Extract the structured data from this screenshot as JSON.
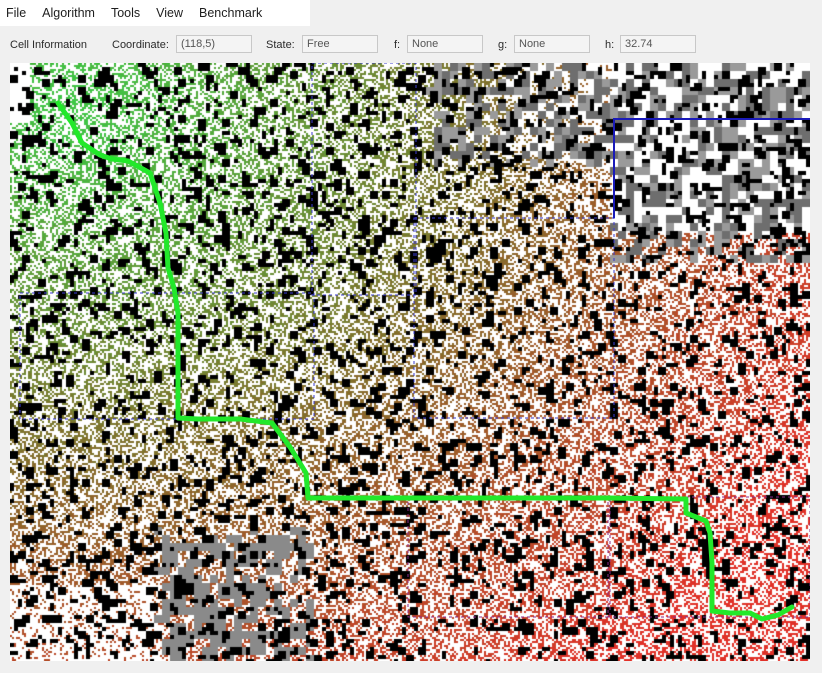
{
  "menu": {
    "items": [
      {
        "label": "File"
      },
      {
        "label": "Algorithm"
      },
      {
        "label": "Tools"
      },
      {
        "label": "View"
      },
      {
        "label": "Benchmark"
      }
    ]
  },
  "cell_info": {
    "title": "Cell Information",
    "coordinate_label": "Coordinate:",
    "coordinate_value": "(118,5)",
    "state_label": "State:",
    "state_value": "Free",
    "f_label": "f:",
    "f_value": "None",
    "g_label": "g:",
    "g_value": "None",
    "h_label": "h:",
    "h_value": "32.74"
  },
  "colors": {
    "path": "#22e82a",
    "obstacle": "#000000",
    "free": "#ffffff",
    "unknown_gray": "#6e6e6e",
    "region_border_blue": "#1a1ab8",
    "region_border_purple": "#8a2a8a",
    "heat_low": "#3ed04a",
    "heat_mid": "#8a6e2e",
    "heat_high": "#e0322a"
  }
}
